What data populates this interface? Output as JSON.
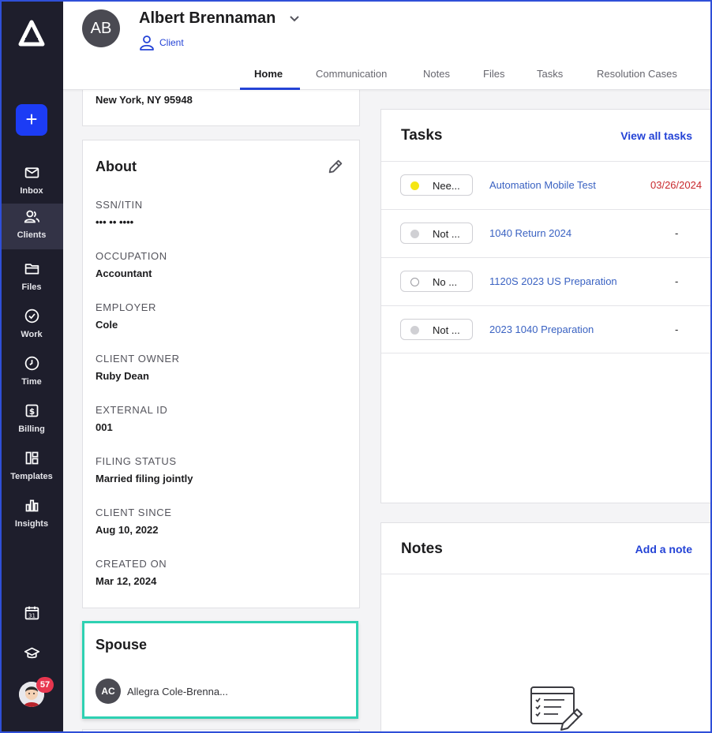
{
  "sidebar": {
    "items": [
      {
        "label": "Inbox",
        "icon": "mail-icon"
      },
      {
        "label": "Clients",
        "icon": "users-icon",
        "active": true
      },
      {
        "label": "Files",
        "icon": "folder-icon"
      },
      {
        "label": "Work",
        "icon": "check-circle-icon"
      },
      {
        "label": "Time",
        "icon": "clock-icon"
      },
      {
        "label": "Billing",
        "icon": "dollar-icon"
      },
      {
        "label": "Templates",
        "icon": "templates-icon"
      },
      {
        "label": "Insights",
        "icon": "bar-chart-icon"
      }
    ],
    "notification_count": "57"
  },
  "header": {
    "avatar_initials": "AB",
    "client_name": "Albert Brennaman",
    "client_type": "Client",
    "tabs": [
      {
        "label": "Home",
        "active": true
      },
      {
        "label": "Communication"
      },
      {
        "label": "Notes"
      },
      {
        "label": "Files"
      },
      {
        "label": "Tasks"
      },
      {
        "label": "Resolution Cases"
      }
    ]
  },
  "address": {
    "city_line": "New York, NY 95948"
  },
  "about": {
    "title": "About",
    "fields": [
      {
        "label": "SSN/ITIN",
        "value": "••• •• ••••"
      },
      {
        "label": "OCCUPATION",
        "value": "Accountant"
      },
      {
        "label": "EMPLOYER",
        "value": "Cole"
      },
      {
        "label": "CLIENT OWNER",
        "value": "Ruby Dean"
      },
      {
        "label": "EXTERNAL ID",
        "value": "001"
      },
      {
        "label": "FILING STATUS",
        "value": "Married filing jointly"
      },
      {
        "label": "CLIENT SINCE",
        "value": "Aug 10, 2022"
      },
      {
        "label": "CREATED ON",
        "value": "Mar 12, 2024"
      }
    ]
  },
  "spouse": {
    "title": "Spouse",
    "initials": "AC",
    "name": "Allegra Cole-Brenna..."
  },
  "tasks": {
    "title": "Tasks",
    "view_all_label": "View all tasks",
    "rows": [
      {
        "status": "Nee...",
        "dot_color": "#f5e614",
        "name": "Automation Mobile Test",
        "due": "03/26/2024"
      },
      {
        "status": "Not ...",
        "dot_color": "#d0d0d4",
        "name": "1040 Return 2024",
        "due": "-"
      },
      {
        "status": "No ...",
        "dot_color": "#ffffff",
        "name": "1120S 2023 US Preparation",
        "due": "-"
      },
      {
        "status": "Not ...",
        "dot_color": "#d0d0d4",
        "name": "2023 1040 Preparation",
        "due": "-"
      }
    ]
  },
  "notes": {
    "title": "Notes",
    "add_label": "Add a note"
  },
  "colors": {
    "accent": "#2443d6",
    "sidebar_bg": "#1e1e2c",
    "highlight_border": "#2ed1b2",
    "overdue": "#c8282c"
  }
}
